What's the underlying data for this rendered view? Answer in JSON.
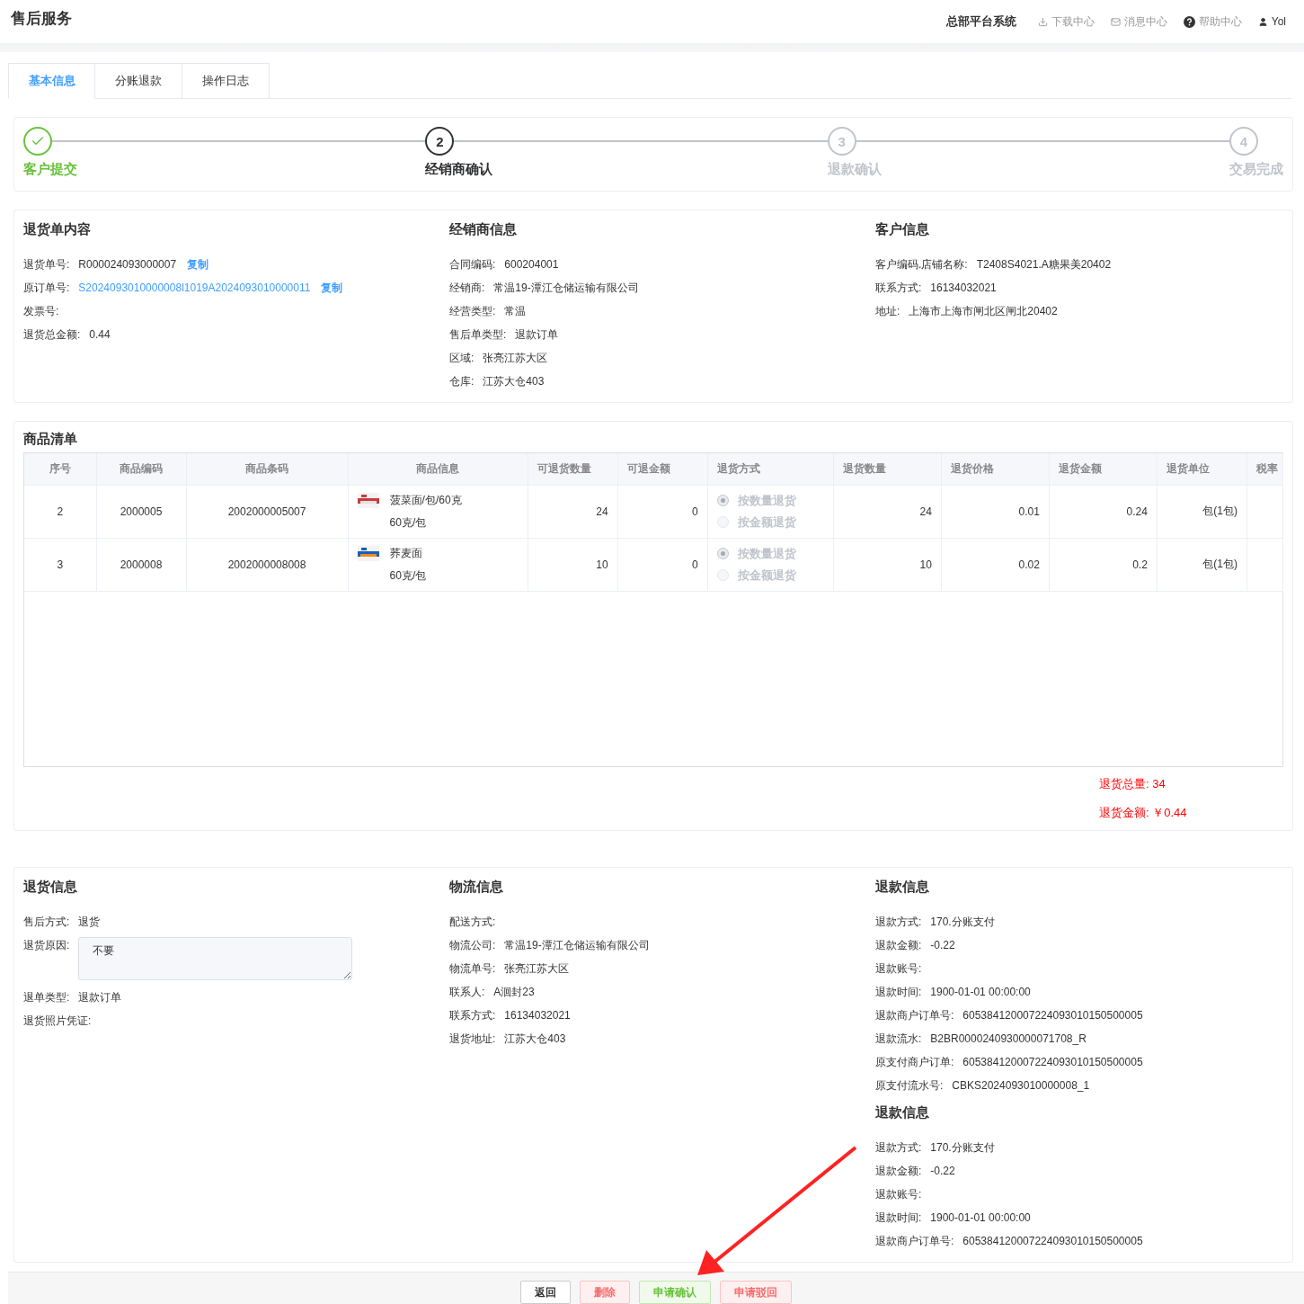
{
  "header": {
    "title": "售后服务",
    "system": "总部平台系统",
    "links": [
      {
        "label": "下载中心"
      },
      {
        "label": "消息中心"
      },
      {
        "label": "帮助中心"
      },
      {
        "label": "Yol"
      }
    ]
  },
  "tabs": [
    {
      "label": "基本信息",
      "selected": true
    },
    {
      "label": "分账退款",
      "selected": false
    },
    {
      "label": "操作日志",
      "selected": false
    }
  ],
  "steps": [
    {
      "title": "客户提交",
      "completed": true,
      "selected": false
    },
    {
      "number": "2",
      "title": "经销商确认",
      "completed": false,
      "selected": true
    },
    {
      "number": "3",
      "title": "退款确认",
      "completed": false,
      "selected": false
    },
    {
      "number": "4",
      "title": "交易完成",
      "completed": false,
      "selected": false
    }
  ],
  "info": [
    [
      {
        "title": "退货单内容",
        "fields": [
          {
            "kind": "text",
            "label": "退货单号:",
            "value": "R000024093000007",
            "action": "复制"
          },
          {
            "kind": "link",
            "label": "原订单号:",
            "value": "S2024093010000008l1019A2024093010000011",
            "action": "复制"
          },
          {
            "kind": "text",
            "label": "发票号:"
          },
          {
            "kind": "text",
            "label": "退货总金额:",
            "value": "0.44"
          }
        ]
      }
    ],
    [
      {
        "title": "经销商信息",
        "fields": [
          {
            "kind": "text",
            "label": "合同编码:",
            "value": "600204001"
          },
          {
            "kind": "text",
            "label": "经销商:",
            "value": "常温19-潭江仓储运输有限公司"
          },
          {
            "kind": "text",
            "label": "经营类型:",
            "value": "常温"
          },
          {
            "kind": "text",
            "label": "售后单类型:",
            "value": "退款订单"
          },
          {
            "kind": "text",
            "label": "区域:",
            "value": "张亮江苏大区"
          },
          {
            "kind": "text",
            "label": "仓库:",
            "value": "江苏大仓403"
          }
        ]
      }
    ],
    [
      {
        "title": "客户信息",
        "fields": [
          {
            "kind": "text",
            "label": "客户编码.店铺名称:",
            "value": "T2408S4021.A糖果美20402"
          },
          {
            "kind": "text",
            "label": "联系方式:",
            "value": "16134032021"
          },
          {
            "kind": "text",
            "label": "地址:",
            "value": "上海市上海市闸北区闸北20402"
          }
        ]
      }
    ]
  ],
  "goods": {
    "title": "商品清单",
    "columns": [
      "序号",
      "商品编码",
      "商品条码",
      "商品信息",
      "可退货数量",
      "可退金额",
      "退货方式",
      "退货数量",
      "退货价格",
      "退货金额",
      "退货单位",
      "税率"
    ],
    "rows": [
      {
        "index": "2",
        "code": "2000005",
        "barcode": "2002000005007",
        "name": "菠菜面/包/60克",
        "spec": "60克/包",
        "returnable_qty": "24",
        "returnable_amount": "0",
        "methods": [
          {
            "label": "按数量退货",
            "selected": true
          },
          {
            "label": "按金额退货",
            "selected": false
          }
        ],
        "qty": "24",
        "price": "0.01",
        "amount": "0.24",
        "unit": "包(1包)"
      },
      {
        "index": "3",
        "code": "2000008",
        "barcode": "2002000008008",
        "name": "荞麦面",
        "spec": "60克/包",
        "returnable_qty": "10",
        "returnable_amount": "0",
        "methods": [
          {
            "label": "按数量退货",
            "selected": true
          },
          {
            "label": "按金额退货",
            "selected": false
          }
        ],
        "qty": "10",
        "price": "0.02",
        "amount": "0.2",
        "unit": "包(1包)"
      }
    ],
    "summary": [
      "退货总量: 34",
      "退货金额: ￥0.44"
    ]
  },
  "details": [
    [
      {
        "title": "退货信息",
        "fields": [
          {
            "kind": "text",
            "label": "售后方式:",
            "value": "退货"
          },
          {
            "kind": "textarea",
            "label": "退货原因:",
            "value": "不要"
          },
          {
            "kind": "text",
            "label": "退单类型:",
            "value": "退款订单"
          },
          {
            "kind": "text",
            "label": "退货照片凭证:"
          }
        ]
      }
    ],
    [
      {
        "title": "物流信息",
        "fields": [
          {
            "kind": "text",
            "label": "配送方式:"
          },
          {
            "kind": "text",
            "label": "物流公司:",
            "value": "常温19-潭江仓储运输有限公司"
          },
          {
            "kind": "text",
            "label": "物流单号:",
            "value": "张亮江苏大区"
          },
          {
            "kind": "text",
            "label": "联系人:",
            "value": "A洄封23"
          },
          {
            "kind": "text",
            "label": "联系方式:",
            "value": "16134032021"
          },
          {
            "kind": "text",
            "label": "退货地址:",
            "value": "江苏大仓403"
          }
        ]
      }
    ],
    [
      {
        "title": "退款信息",
        "fields": [
          {
            "kind": "text",
            "label": "退款方式:",
            "value": "170.分账支付"
          },
          {
            "kind": "text",
            "label": "退款金额:",
            "value": "-0.22"
          },
          {
            "kind": "text",
            "label": "退款账号:"
          },
          {
            "kind": "text",
            "label": "退款时间:",
            "value": "1900-01-01 00:00:00"
          },
          {
            "kind": "text",
            "label": "退款商户订单号:",
            "value": "605384120007224093010150500005"
          },
          {
            "kind": "text",
            "label": "退款流水:",
            "value": "B2BR0000240930000071708_R"
          },
          {
            "kind": "text",
            "label": "原支付商户订单:",
            "value": "605384120007224093010150500005"
          },
          {
            "kind": "text",
            "label": "原支付流水号:",
            "value": "CBKS2024093010000008_1"
          }
        ]
      },
      {
        "title": "退款信息",
        "fields": [
          {
            "kind": "text",
            "label": "退款方式:",
            "value": "170.分账支付"
          },
          {
            "kind": "text",
            "label": "退款金额:",
            "value": "-0.22"
          },
          {
            "kind": "text",
            "label": "退款账号:"
          },
          {
            "kind": "text",
            "label": "退款时间:",
            "value": "1900-01-01 00:00:00"
          },
          {
            "kind": "text",
            "label": "退款商户订单号:",
            "value": "605384120007224093010150500005"
          }
        ]
      }
    ]
  ],
  "footer": [
    {
      "label": "返回",
      "kind": "default"
    },
    {
      "label": "删除",
      "kind": "danger"
    },
    {
      "label": "申请确认",
      "kind": "success"
    },
    {
      "label": "申请驳回",
      "kind": "danger"
    }
  ]
}
